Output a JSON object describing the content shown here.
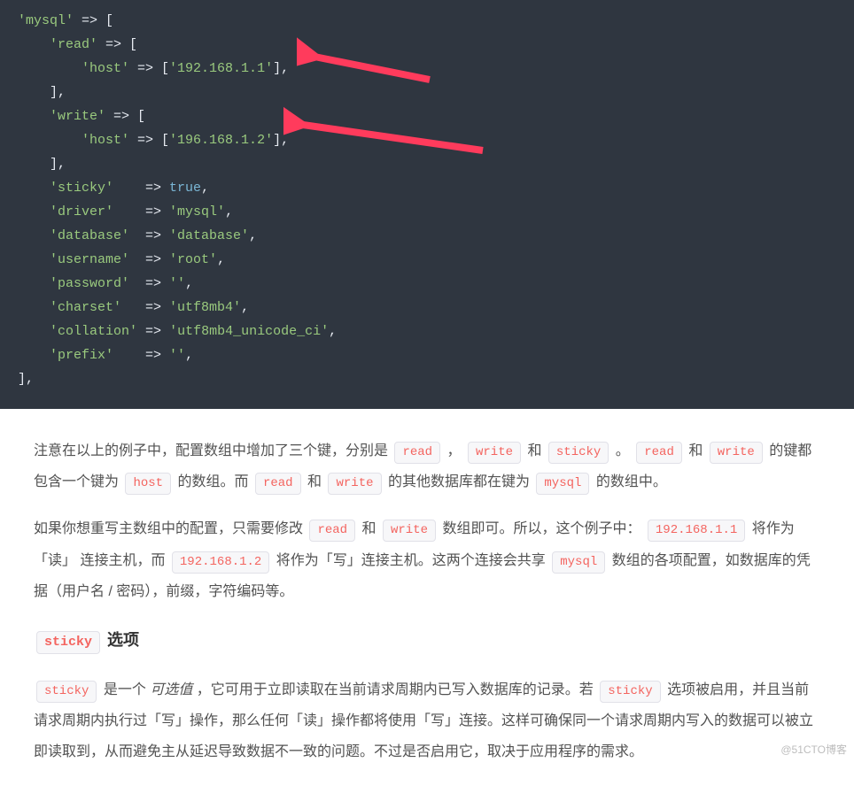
{
  "code": {
    "lines": [
      {
        "indent": 0,
        "tokens": [
          {
            "t": "str",
            "v": "'mysql'"
          },
          {
            "t": "pun",
            "v": " => ["
          }
        ]
      },
      {
        "indent": 1,
        "tokens": [
          {
            "t": "str",
            "v": "'read'"
          },
          {
            "t": "pun",
            "v": " => ["
          }
        ]
      },
      {
        "indent": 2,
        "tokens": [
          {
            "t": "str",
            "v": "'host'"
          },
          {
            "t": "pun",
            "v": " => ["
          },
          {
            "t": "str",
            "v": "'192.168.1.1'"
          },
          {
            "t": "pun",
            "v": "],"
          }
        ]
      },
      {
        "indent": 1,
        "tokens": [
          {
            "t": "pun",
            "v": "],"
          }
        ]
      },
      {
        "indent": 1,
        "tokens": [
          {
            "t": "str",
            "v": "'write'"
          },
          {
            "t": "pun",
            "v": " => ["
          }
        ]
      },
      {
        "indent": 2,
        "tokens": [
          {
            "t": "str",
            "v": "'host'"
          },
          {
            "t": "pun",
            "v": " => ["
          },
          {
            "t": "str",
            "v": "'196.168.1.2'"
          },
          {
            "t": "pun",
            "v": "],"
          }
        ]
      },
      {
        "indent": 1,
        "tokens": [
          {
            "t": "pun",
            "v": "],"
          }
        ]
      },
      {
        "indent": 1,
        "tokens": [
          {
            "t": "str",
            "v": "'sticky'"
          },
          {
            "t": "pun",
            "v": "    => "
          },
          {
            "t": "bool",
            "v": "true"
          },
          {
            "t": "pun",
            "v": ","
          }
        ]
      },
      {
        "indent": 1,
        "tokens": [
          {
            "t": "str",
            "v": "'driver'"
          },
          {
            "t": "pun",
            "v": "    => "
          },
          {
            "t": "str",
            "v": "'mysql'"
          },
          {
            "t": "pun",
            "v": ","
          }
        ]
      },
      {
        "indent": 1,
        "tokens": [
          {
            "t": "str",
            "v": "'database'"
          },
          {
            "t": "pun",
            "v": "  => "
          },
          {
            "t": "str",
            "v": "'database'"
          },
          {
            "t": "pun",
            "v": ","
          }
        ]
      },
      {
        "indent": 1,
        "tokens": [
          {
            "t": "str",
            "v": "'username'"
          },
          {
            "t": "pun",
            "v": "  => "
          },
          {
            "t": "str",
            "v": "'root'"
          },
          {
            "t": "pun",
            "v": ","
          }
        ]
      },
      {
        "indent": 1,
        "tokens": [
          {
            "t": "str",
            "v": "'password'"
          },
          {
            "t": "pun",
            "v": "  => "
          },
          {
            "t": "str",
            "v": "''"
          },
          {
            "t": "pun",
            "v": ","
          }
        ]
      },
      {
        "indent": 1,
        "tokens": [
          {
            "t": "str",
            "v": "'charset'"
          },
          {
            "t": "pun",
            "v": "   => "
          },
          {
            "t": "str",
            "v": "'utf8mb4'"
          },
          {
            "t": "pun",
            "v": ","
          }
        ]
      },
      {
        "indent": 1,
        "tokens": [
          {
            "t": "str",
            "v": "'collation'"
          },
          {
            "t": "pun",
            "v": " => "
          },
          {
            "t": "str",
            "v": "'utf8mb4_unicode_ci'"
          },
          {
            "t": "pun",
            "v": ","
          }
        ]
      },
      {
        "indent": 1,
        "tokens": [
          {
            "t": "str",
            "v": "'prefix'"
          },
          {
            "t": "pun",
            "v": "    => "
          },
          {
            "t": "str",
            "v": "''"
          },
          {
            "t": "pun",
            "v": ","
          }
        ]
      },
      {
        "indent": 0,
        "tokens": [
          {
            "t": "pun",
            "v": "],"
          }
        ]
      }
    ]
  },
  "para1": {
    "s1": "注意在以上的例子中，配置数组中增加了三个键，分别是 ",
    "c1": "read",
    "s2": "，",
    "c2": "write",
    "s3": " 和 ",
    "c3": "sticky",
    "s4": "。",
    "c4": "read",
    "s5": " 和 ",
    "c5": "write",
    "s6": " 的键都包含一个键为 ",
    "c6": "host",
    "s7": " 的数组。而 ",
    "c7": "read",
    "s8": " 和 ",
    "c8": "write",
    "s9": " 的其他数据库都在键为 ",
    "c9": "mysql",
    "s10": " 的数组中。"
  },
  "para2": {
    "s1": "如果你想重写主数组中的配置，只需要修改 ",
    "c1": "read",
    "s2": " 和 ",
    "c2": "write",
    "s3": " 数组即可。所以，这个例子中： ",
    "c3": "192.168.1.1",
    "s4": " 将作为 「读」 连接主机，而 ",
    "c4": "192.168.1.2",
    "s5": " 将作为「写」连接主机。这两个连接会共享 ",
    "c5": "mysql",
    "s6": " 数组的各项配置，如数据库的凭据（用户名 / 密码），前缀，字符编码等。"
  },
  "heading": {
    "code": "sticky",
    "text": " 选项"
  },
  "para3": {
    "c1": "sticky",
    "s1": " 是一个 ",
    "em": "可选值",
    "s2": "，它可用于立即读取在当前请求周期内已写入数据库的记录。若 ",
    "c2": "sticky",
    "s3": " 选项被启用，并且当前请求周期内执行过「写」操作，那么任何「读」操作都将使用「写」连接。这样可确保同一个请求周期内写入的数据可以被立即读取到，从而避免主从延迟导致数据不一致的问题。不过是否启用它，取决于应用程序的需求。"
  },
  "watermark": "@51CTO博客"
}
